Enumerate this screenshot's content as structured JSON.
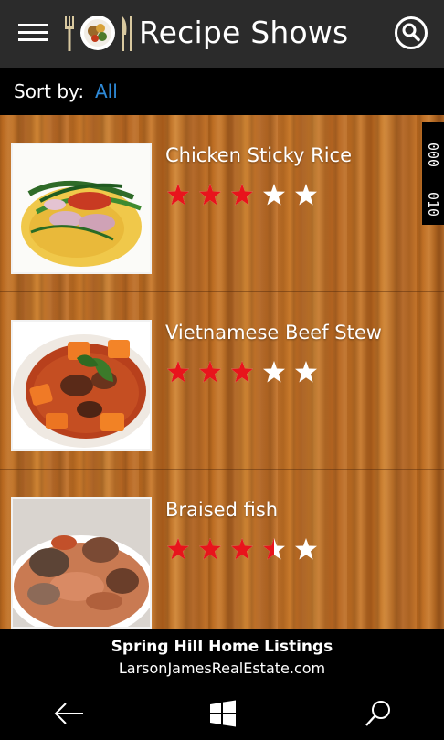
{
  "header": {
    "title": "Recipe Shows",
    "menu_icon": "hamburger-menu-icon",
    "logo_icon": "fork-plate-knife-logo",
    "search_icon": "search-icon"
  },
  "sort": {
    "label": "Sort by:",
    "value": "All",
    "value_color": "#2e8ad8"
  },
  "recipes": [
    {
      "name": "Chicken Sticky Rice",
      "rating": 3,
      "max_rating": 5
    },
    {
      "name": "Vietnamese Beef Stew",
      "rating": 3,
      "max_rating": 5
    },
    {
      "name": "Braised fish",
      "rating": 3.5,
      "max_rating": 5
    }
  ],
  "side_counter": {
    "top": "000",
    "bottom": "010"
  },
  "ad": {
    "title": "Spring Hill Home Listings",
    "url": "LarsonJamesRealEstate.com"
  },
  "navbar": {
    "back_icon": "back-arrow-icon",
    "start_icon": "windows-start-icon",
    "search_icon": "search-icon"
  },
  "colors": {
    "star_filled": "#e8141c",
    "star_empty": "#ffffff",
    "header_bg": "#2b2b2b"
  }
}
